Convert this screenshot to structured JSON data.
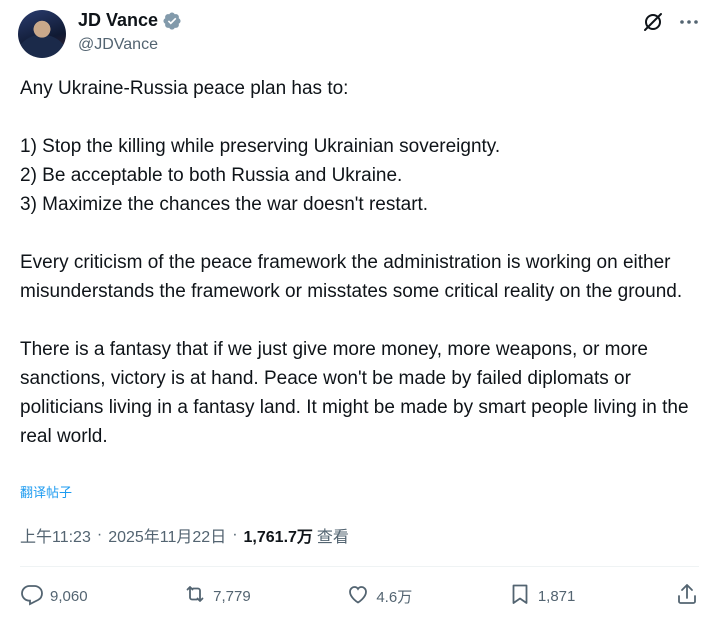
{
  "author": {
    "display_name": "JD Vance",
    "handle": "@JDVance",
    "verified_color": "#829aab"
  },
  "post": {
    "text": "Any Ukraine-Russia peace plan has to:\n\n1) Stop the killing while preserving Ukrainian sovereignty.\n2) Be acceptable to both Russia and Ukraine.\n3) Maximize the chances the war doesn't restart.\n\nEvery criticism of the peace framework the administration is working on either misunderstands the framework or misstates some critical reality on the ground.\n\nThere is a fantasy that if we just give more money, more weapons, or more sanctions, victory is at hand. Peace won't be made by failed diplomats or politicians living in a fantasy land. It might be made by smart people living in the real world.",
    "translate_label": "翻译帖子"
  },
  "meta": {
    "time": "上午11:23",
    "separator": "·",
    "date": "2025年11月22日",
    "views_count": "1,761.7万",
    "views_label": "查看"
  },
  "actions": {
    "replies": "9,060",
    "reposts": "7,779",
    "likes": "4.6万",
    "bookmarks": "1,871"
  },
  "icons": [
    "verified-badge-icon",
    "grok-icon",
    "more-icon",
    "reply-icon",
    "repost-icon",
    "like-icon",
    "bookmark-icon",
    "share-icon"
  ],
  "colors": {
    "text": "#0f1419",
    "secondary": "#536471",
    "link": "#1d9bf0"
  }
}
